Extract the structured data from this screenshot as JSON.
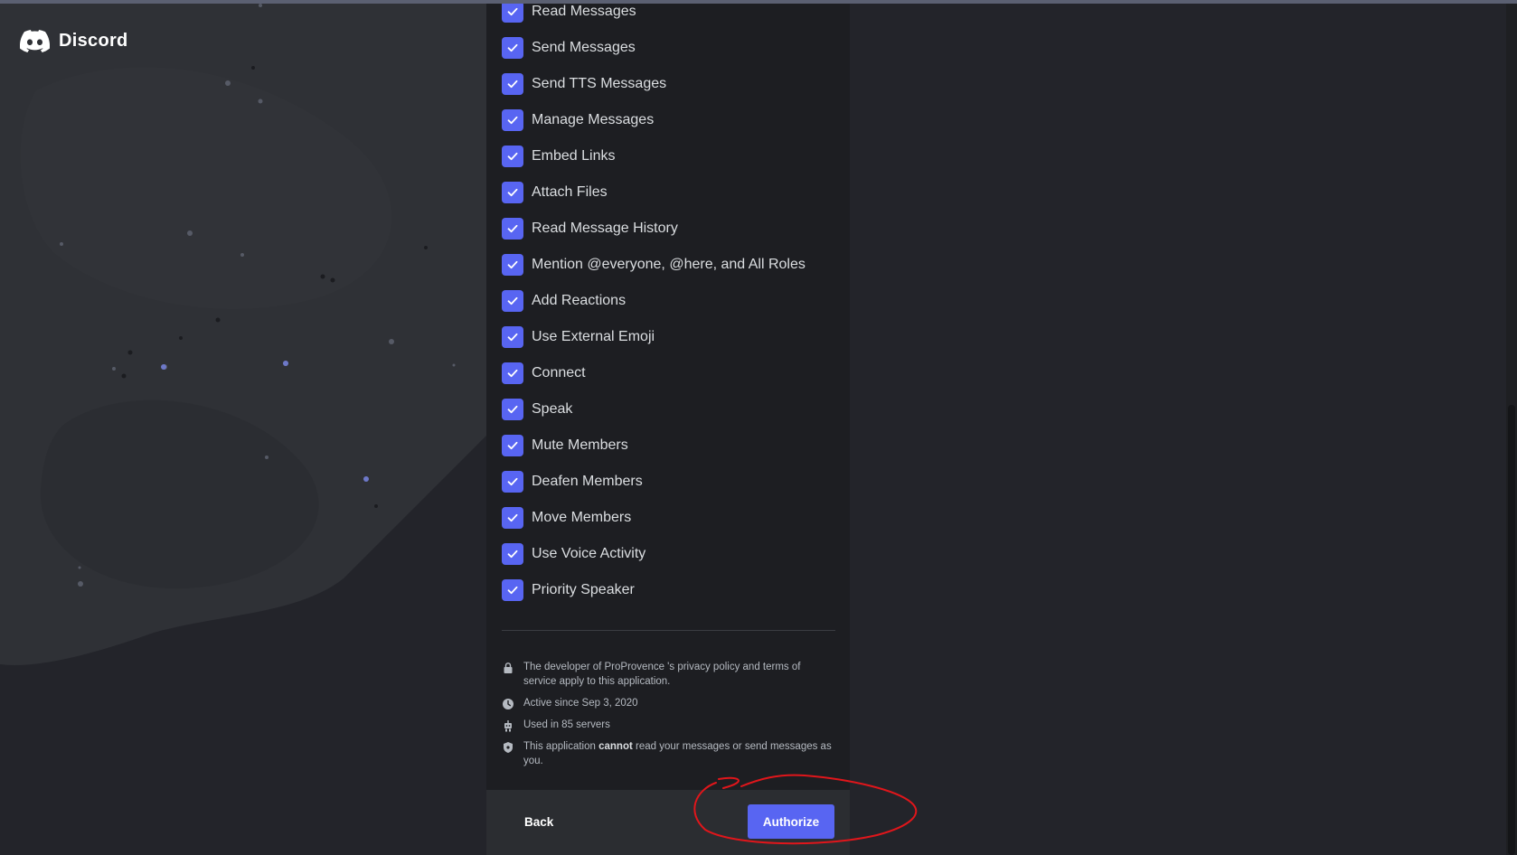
{
  "brand": {
    "name": "Discord",
    "icon": "discord-logo-icon"
  },
  "permissions": [
    {
      "label": "Read Messages",
      "checked": true
    },
    {
      "label": "Send Messages",
      "checked": true
    },
    {
      "label": "Send TTS Messages",
      "checked": true
    },
    {
      "label": "Manage Messages",
      "checked": true
    },
    {
      "label": "Embed Links",
      "checked": true
    },
    {
      "label": "Attach Files",
      "checked": true
    },
    {
      "label": "Read Message History",
      "checked": true
    },
    {
      "label": "Mention @everyone, @here, and All Roles",
      "checked": true
    },
    {
      "label": "Add Reactions",
      "checked": true
    },
    {
      "label": "Use External Emoji",
      "checked": true
    },
    {
      "label": "Connect",
      "checked": true
    },
    {
      "label": "Speak",
      "checked": true
    },
    {
      "label": "Mute Members",
      "checked": true
    },
    {
      "label": "Deafen Members",
      "checked": true
    },
    {
      "label": "Move Members",
      "checked": true
    },
    {
      "label": "Use Voice Activity",
      "checked": true
    },
    {
      "label": "Priority Speaker",
      "checked": true
    }
  ],
  "info": {
    "privacy": "The developer of ProProvence 's privacy policy and terms of service apply to this application.",
    "active_since": "Active since Sep 3, 2020",
    "used_in": "Used in 85 servers",
    "cannot_prefix": "This application ",
    "cannot_word": "cannot",
    "cannot_suffix": " read your messages or send messages as you."
  },
  "footer": {
    "back_label": "Back",
    "authorize_label": "Authorize"
  },
  "colors": {
    "accent": "#5865f2",
    "annotation": "#e0161b"
  }
}
